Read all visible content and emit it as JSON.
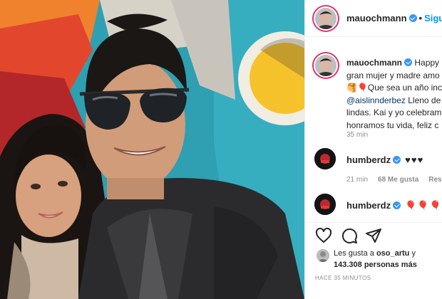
{
  "post": {
    "photo_alt": "selfie",
    "author": "mauochmann",
    "separator": "•",
    "follow_label": "Siguiendo"
  },
  "caption": {
    "user": "mauochmann",
    "line1": "Happy",
    "line2": "gran mujer y madre amo",
    "line3": "🥞🎈Que sea un año inc",
    "line4_link": "@aislinnderbez",
    "line4_rest": " Lleno de",
    "line5": "lindas. Kai y yo celebram",
    "line6": "honramos tu vida, feliz c",
    "time": "35 min"
  },
  "comments": [
    {
      "user": "humberdz",
      "text": "♥♥♥",
      "time": "21 min",
      "likes": "68 Me gusta",
      "reply": "Responder"
    },
    {
      "user": "humberdz",
      "text": "🎈🎈🎈"
    }
  ],
  "actions": {
    "like_icon": "heart-icon",
    "comment_icon": "comment-icon",
    "share_icon": "share-icon"
  },
  "likes": {
    "prefix": "Les gusta a",
    "user": "oso_artu",
    "joiner": "y",
    "count": "143.308",
    "suffix": "personas más"
  },
  "timestamp": "HACE 35 MINUTOS",
  "colors": {
    "verified": "#3897f0",
    "link": "#00376b",
    "follow": "#0095f6",
    "muted": "#8e8e8e"
  }
}
